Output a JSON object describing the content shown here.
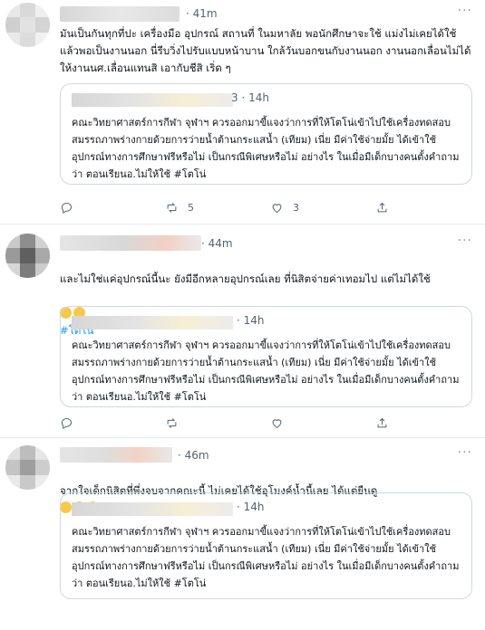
{
  "tweets": [
    {
      "time": "41m",
      "text": "มันเป็นกันทุกที่ปะ เครื่องมือ อุปกรณ์ สถานที่ ในมหาลัย พอนักศึกษาจะใช้ แม่งไม่เคยได้ใช้ แล้วพอเป็นงานนอก นี่รีบวิ่งไปรับแบบหน้าบาน ใกล้วันบอกขนกับงานนอก งานนอกเลื่อนไม่ได้ให้งานนศ.เลื่อนแทนสิ เอากับชีสิ เริ่ด ๆ",
      "hashtag": "",
      "quote": {
        "time_prefix": "3 · 14h",
        "text": "คณะวิทยาศาสตร์การกีฬา จุฬาฯ ควรออกมาขี้แจงว่าการที่ให้โตโน่เข้าไปใช้เครื่องทดสอบสมรรถภาพร่างกายด้วยการว่ายน้ำต้านกระแสน้ำ (เทียม) เนี่ย มีค่าใช้จ่ายมั้ย ได้เข้าใช้อุปกรณ์ทางการศึกษาฟรีหรือไม่ เป็นกรณีพิเศษหรือไม่ อย่างไร ในเมื่อมีเด็กบางคนตั้งคำถามว่า ตอนเรียนอ.ไม่ให้ใช้ #โตโน่"
      },
      "actions": {
        "reply": "",
        "retweet": "5",
        "like": "3"
      }
    },
    {
      "time": "44m",
      "text": "และไม่ใช่แค่อุปกรณ์นี้นะ ยังมีอีกหลายอุปกรณ์เลย ที่นิสิตจ่ายค่าเทอมไป แต่ไม่ได้ใช้",
      "hashtag": "#โตโน่",
      "quote": {
        "time_prefix": "· 14h",
        "text": "คณะวิทยาศาสตร์การกีฬา จุฬาฯ ควรออกมาขี้แจงว่าการที่ให้โตโน่เข้าไปใช้เครื่องทดสอบสมรรถภาพร่างกายด้วยการว่ายน้ำต้านกระแสน้ำ (เทียม) เนี่ย มีค่าใช้จ่ายมั้ย ได้เข้าใช้อุปกรณ์ทางการศึกษาฟรีหรือไม่ เป็นกรณีพิเศษหรือไม่ อย่างไร ในเมื่อมีเด็กบางคนตั้งคำถามว่า ตอนเรียนอ.ไม่ให้ใช้ #โตโน่"
      },
      "actions": {
        "reply": "",
        "retweet": "",
        "like": ""
      }
    },
    {
      "time": "46m",
      "text": "จากใจเด็กนิสิตที่พึ่งจบจากคณะนี้ ไม่เคยได้ใช้อุโมงค์น้ำนี้เลย ได้แต่ยืนดู",
      "hashtag": "",
      "quote": {
        "time_prefix": "· 14h",
        "text": "คณะวิทยาศาสตร์การกีฬา จุฬาฯ ควรออกมาขี้แจงว่าการที่ให้โตโน่เข้าไปใช้เครื่องทดสอบสมรรถภาพร่างกายด้วยการว่ายน้ำต้านกระแสน้ำ (เทียม) เนี่ย มีค่าใช้จ่ายมั้ย ได้เข้าใช้อุปกรณ์ทางการศึกษาฟรีหรือไม่ เป็นกรณีพิเศษหรือไม่ อย่างไร ในเมื่อมีเด็กบางคนตั้งคำถามว่า ตอนเรียนอ.ไม่ให้ใช้ #โตโน่"
      },
      "actions": {
        "reply": "",
        "retweet": "",
        "like": ""
      }
    }
  ],
  "more_glyph": "···",
  "colors": {
    "link": "#1d9bf0",
    "muted": "#536471",
    "border": "#cfd9de"
  }
}
